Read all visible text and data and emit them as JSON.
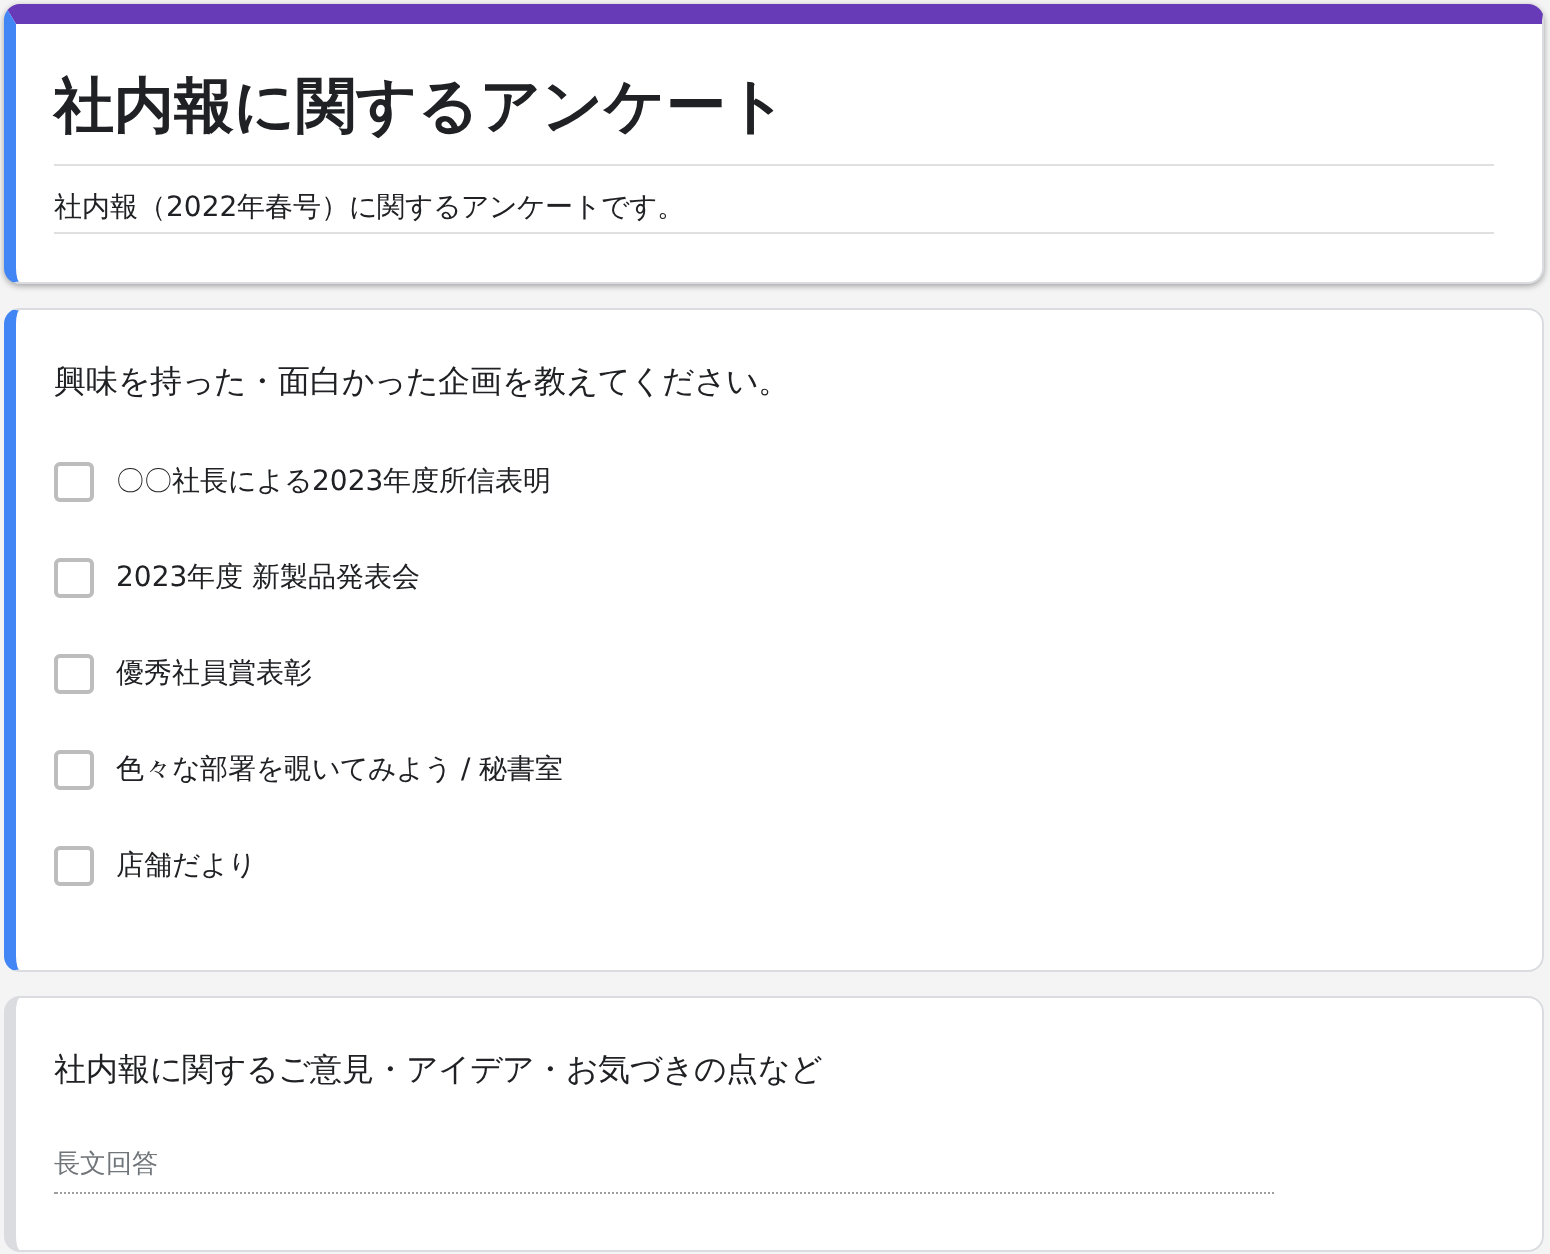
{
  "header": {
    "title": "社内報に関するアンケート",
    "description": "社内報（2022年春号）に関するアンケートです。",
    "focused": true
  },
  "questions": [
    {
      "kind": "checkboxes",
      "focused": true,
      "text": "興味を持った・面白かった企画を教えてください。",
      "options": [
        {
          "label": "〇〇社長による2023年度所信表明",
          "checked": false
        },
        {
          "label": "2023年度 新製品発表会",
          "checked": false
        },
        {
          "label": "優秀社員賞表彰",
          "checked": false
        },
        {
          "label": "色々な部署を覗いてみよう / 秘書室",
          "checked": false
        },
        {
          "label": "店舗だより",
          "checked": false
        }
      ]
    },
    {
      "kind": "paragraph",
      "focused": false,
      "text": "社内報に関するご意見・アイデア・お気づきの点など",
      "placeholder": "長文回答"
    }
  ]
}
